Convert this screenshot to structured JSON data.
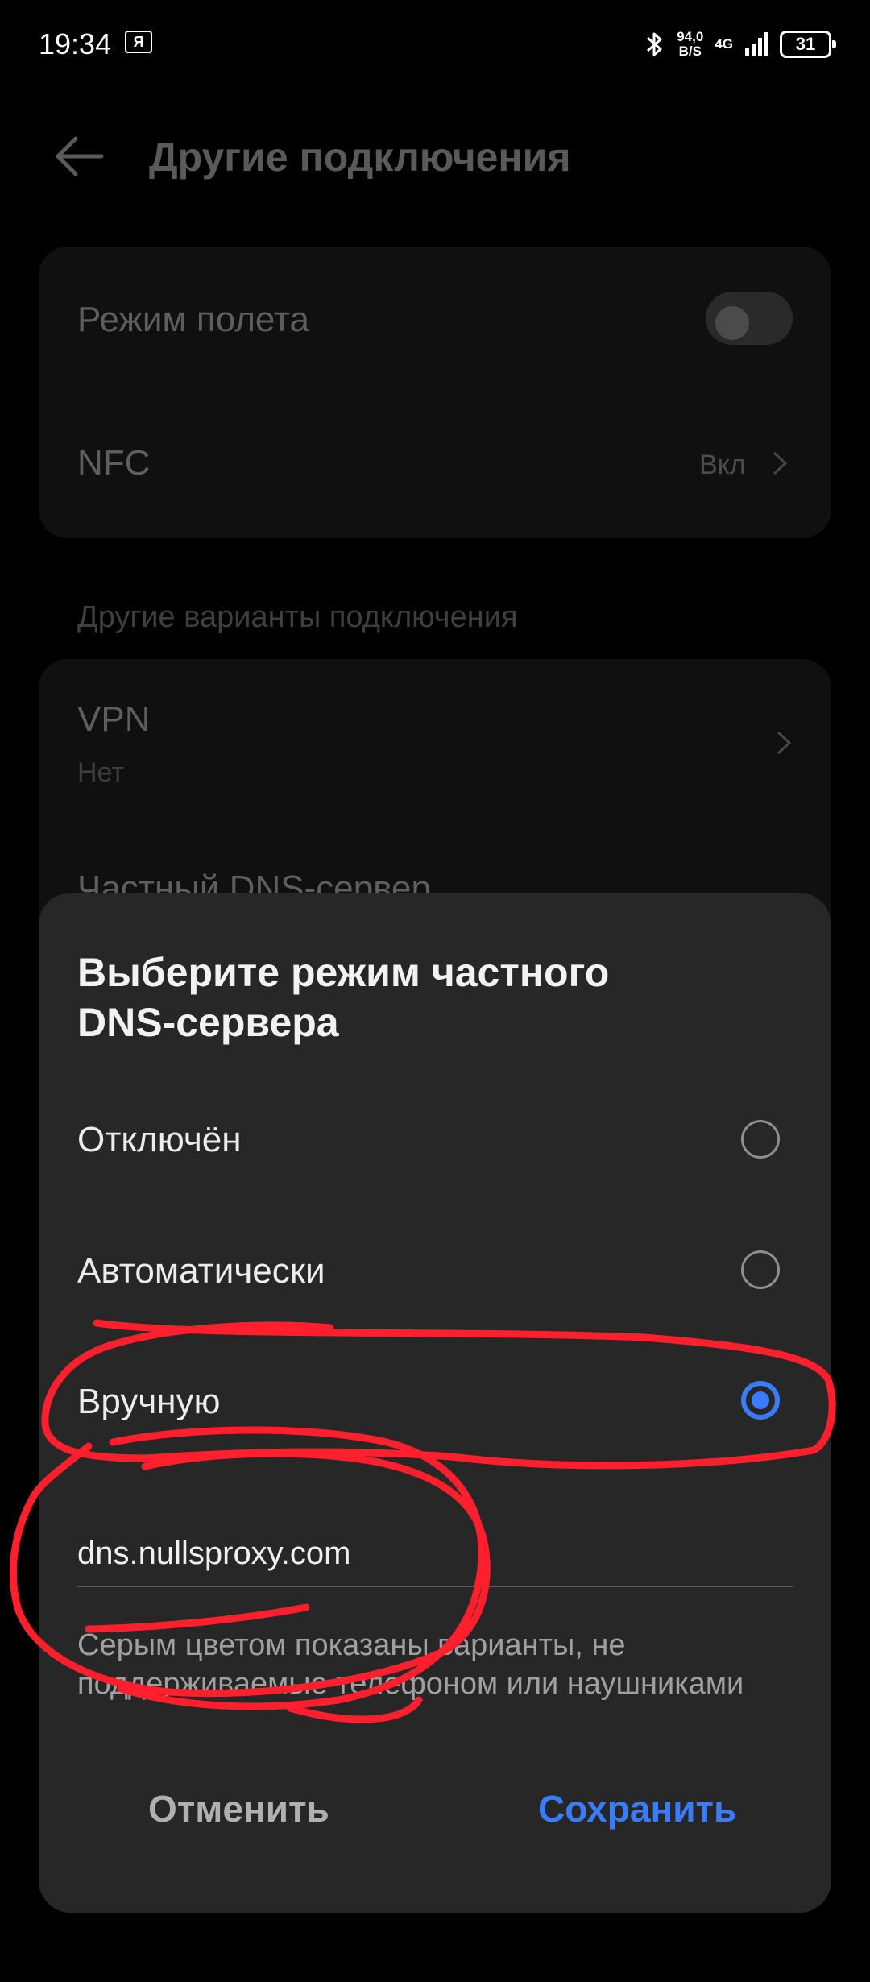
{
  "status_bar": {
    "time": "19:34",
    "notification_icon_letter": "Я",
    "speed_value": "94,0",
    "speed_unit": "B/S",
    "network": "4G",
    "battery": "31"
  },
  "header": {
    "title": "Другие подключения"
  },
  "settings": {
    "airplane_mode": {
      "label": "Режим полета"
    },
    "nfc": {
      "label": "NFC",
      "value": "Вкл"
    },
    "section_header": "Другие варианты подключения",
    "vpn": {
      "label": "VPN",
      "value": "Нет"
    },
    "private_dns": {
      "label": "Частный DNS-сервер"
    }
  },
  "dialog": {
    "title": "Выберите режим частного\nDNS-сервера",
    "options": [
      {
        "label": "Отключён",
        "selected": false
      },
      {
        "label": "Автоматически",
        "selected": false
      },
      {
        "label": "Вручную",
        "selected": true
      }
    ],
    "hostname_value": "dns.nullsproxy.com",
    "hint": "Серым цветом показаны варианты, не поддерживаемые телефоном или наушниками",
    "cancel_label": "Отменить",
    "save_label": "Сохранить"
  },
  "colors": {
    "accent": "#3a7cff",
    "annotation": "#ff1f2d"
  }
}
